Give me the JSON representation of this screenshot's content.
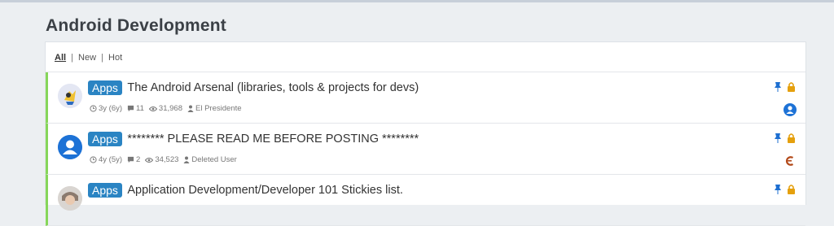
{
  "page": {
    "title": "Android Development"
  },
  "filters": {
    "all": "All",
    "new": "New",
    "hot": "Hot",
    "separator": "|"
  },
  "topics": [
    {
      "badge": "Apps",
      "title": "The Android Arsenal (libraries, tools & projects for devs)",
      "age": "3y (6y)",
      "replies": "11",
      "views": "31,968",
      "author": "El Presidente",
      "pinned": true,
      "locked": true,
      "last_poster_icon": "user-circle-icon"
    },
    {
      "badge": "Apps",
      "title": "******** PLEASE READ ME BEFORE POSTING ********",
      "age": "4y (5y)",
      "replies": "2",
      "views": "34,523",
      "author": "Deleted User",
      "pinned": true,
      "locked": true,
      "last_poster_icon": "letter-avatar-icon"
    },
    {
      "badge": "Apps",
      "title": "Application Development/Developer 101 Stickies list.",
      "pinned": true,
      "locked": true
    }
  ],
  "colors": {
    "accent_border": "#86d65a",
    "badge_bg": "#2a84c3",
    "pin": "#1d6fd1",
    "lock": "#e5a00d"
  }
}
